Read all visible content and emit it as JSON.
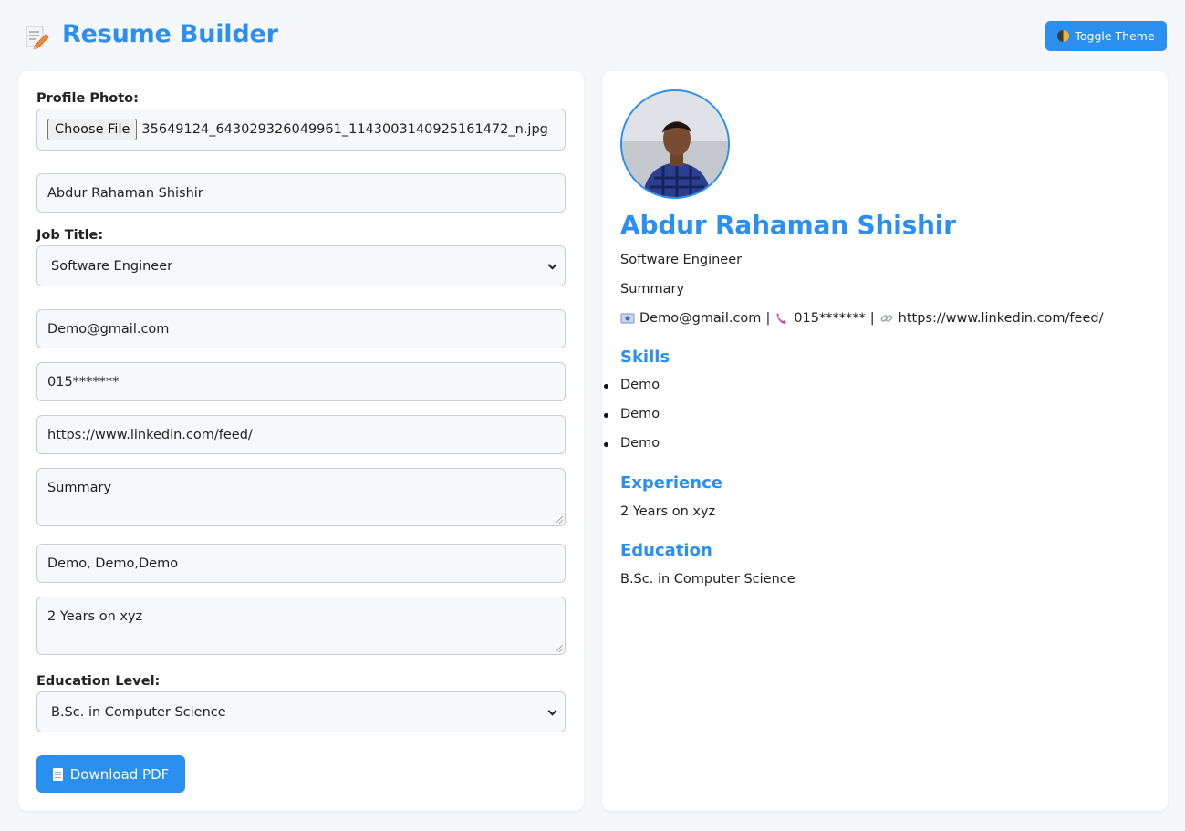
{
  "header": {
    "title": "Resume Builder",
    "toggle_label": "Toggle Theme"
  },
  "form": {
    "photo_label": "Profile Photo:",
    "file_button": "Choose File",
    "file_name": "35649124_643029326049961_1143003140925161472_n.jpg",
    "name_value": "Abdur Rahaman Shishir",
    "job_label": "Job Title:",
    "job_selected": "Software Engineer",
    "email_value": "Demo@gmail.com",
    "phone_value": "015*******",
    "linkedin_value": "https://www.linkedin.com/feed/",
    "summary_value": "Summary",
    "skills_value": "Demo, Demo,Demo",
    "experience_value": "2 Years on xyz",
    "education_label": "Education Level:",
    "education_selected": "B.Sc. in Computer Science",
    "download_label": "Download PDF"
  },
  "preview": {
    "name": "Abdur Rahaman Shishir",
    "job": "Software Engineer",
    "summary": "Summary",
    "email": "Demo@gmail.com",
    "phone": "015*******",
    "linkedin": "https://www.linkedin.com/feed/",
    "separator": "|",
    "skills_heading": "Skills",
    "skills": [
      "Demo",
      "Demo",
      "Demo"
    ],
    "experience_heading": "Experience",
    "experience": "2 Years on xyz",
    "education_heading": "Education",
    "education": "B.Sc. in Computer Science"
  },
  "colors": {
    "accent": "#2b8ff0",
    "background": "#f5f7fb",
    "card": "#ffffff"
  },
  "icons": {
    "logo": "memo-pencil-icon",
    "theme": "half-circle-icon",
    "email": "envelope-icon",
    "phone": "phone-icon",
    "link": "link-icon",
    "download": "document-icon"
  }
}
